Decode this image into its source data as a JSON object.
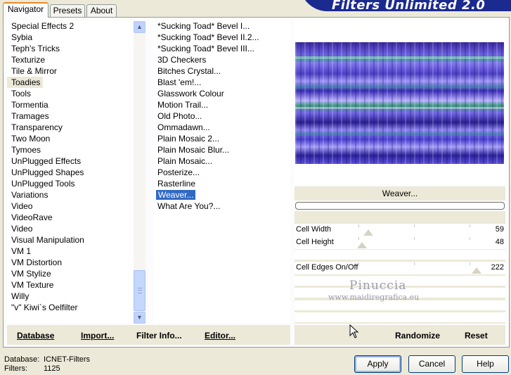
{
  "app": {
    "title": "Filters Unlimited 2.0"
  },
  "tabs": [
    {
      "label": "Navigator",
      "active": true
    },
    {
      "label": "Presets",
      "active": false
    },
    {
      "label": "About",
      "active": false
    }
  ],
  "categories": [
    "Special Effects 2",
    "Sybia",
    "Teph's Tricks",
    "Texturize",
    "Tile & Mirror",
    "Toadies",
    "Tools",
    "Tormentia",
    "Tramages",
    "Transparency",
    "Two Moon",
    "Tymoes",
    "UnPlugged Effects",
    "UnPlugged Shapes",
    "UnPlugged Tools",
    "Variations",
    "Video",
    "VideoRave",
    "Video",
    "Visual Manipulation",
    "VM 1",
    "VM Distortion",
    "VM Stylize",
    "VM Texture",
    "Willy",
    "\"v\" Kiwi`s Oelfilter"
  ],
  "selected_category": "Toadies",
  "filters": [
    "*Sucking Toad*  Bevel I...",
    "*Sucking Toad*  Bevel II.2...",
    "*Sucking Toad*  Bevel III...",
    "3D Checkers",
    "Bitches Crystal...",
    "Blast 'em!...",
    "Glasswork Colour",
    "Motion Trail...",
    "Old Photo...",
    "Ommadawn...",
    "Plain Mosaic 2...",
    "Plain Mosaic Blur...",
    "Plain Mosaic...",
    "Posterize...",
    "Rasterline",
    "Weaver...",
    "What Are You?..."
  ],
  "selected_filter": "Weaver...",
  "preview": {
    "filter_name": "Weaver..."
  },
  "params": [
    {
      "label": "Cell Width",
      "value": "59",
      "level": 0.23
    },
    {
      "label": "Cell Height",
      "value": "48",
      "level": 0.19
    },
    {
      "label": "Cell Edges On/Off",
      "value": "222",
      "level": 0.87
    }
  ],
  "watermark": {
    "main": "Pinuccia",
    "sub": "www.maidiregrafica.eu"
  },
  "buttons": {
    "database": "Database",
    "import": "Import...",
    "filter_info": "Filter Info...",
    "editor": "Editor...",
    "randomize": "Randomize",
    "reset": "Reset",
    "apply": "Apply",
    "cancel": "Cancel",
    "help": "Help"
  },
  "status": {
    "database_label": "Database:",
    "database_value": "ICNET-Filters",
    "filters_label": "Filters:",
    "filters_value": "1125"
  },
  "icons": {
    "scroll_up": "chevron-up-icon",
    "scroll_down": "chevron-down-icon",
    "cursor": "mouse-cursor-icon"
  }
}
